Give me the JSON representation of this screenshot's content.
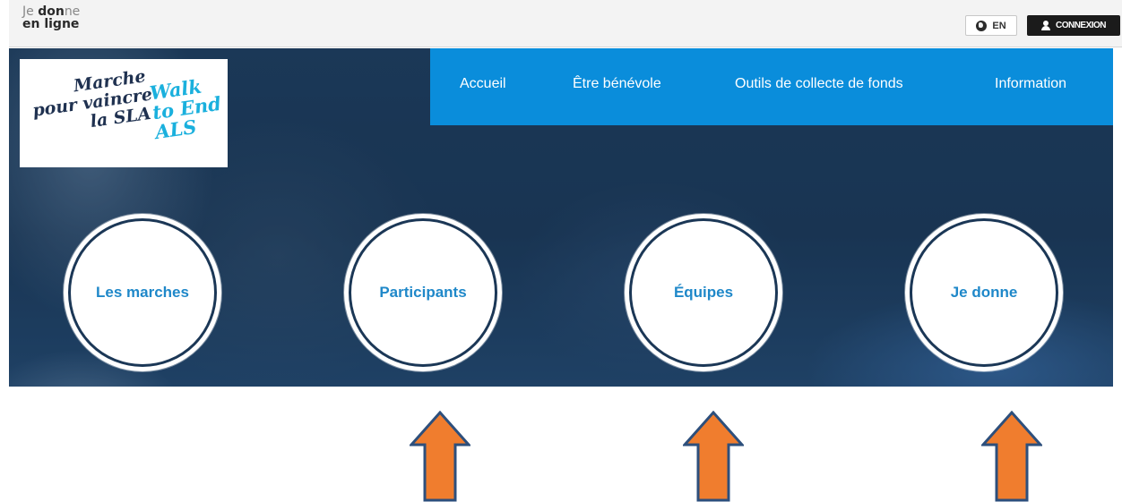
{
  "header": {
    "brand_line1_a": "Je",
    "brand_line1_b": "don",
    "brand_line1_c": "ne",
    "brand_line2": "en ligne",
    "lang_label": "EN",
    "login_label": "CONNEXION",
    "icons": {
      "lang": "globe-icon",
      "login": "user-icon"
    }
  },
  "logo": {
    "fr_line1": "Marche",
    "fr_line2": "pour vaincre",
    "fr_line3": "la SLA",
    "en_line1": "Walk",
    "en_line2": "to End",
    "en_line3": "ALS"
  },
  "nav": {
    "items": [
      {
        "label": "Accueil"
      },
      {
        "label": "Être bénévole"
      },
      {
        "label": "Outils de collecte de fonds"
      },
      {
        "label": "Information"
      }
    ]
  },
  "circles": [
    {
      "label": "Les marches"
    },
    {
      "label": "Participants"
    },
    {
      "label": "Équipes"
    },
    {
      "label": "Je donne"
    }
  ],
  "colors": {
    "nav_bg": "#0a8ddb",
    "circle_text": "#1f88c9",
    "arrow_fill": "#f07d2e",
    "arrow_stroke": "#2d4f7c",
    "login_bg": "#1b1b1b"
  },
  "arrows": {
    "icon": "up-arrow-icon",
    "count": 3
  }
}
